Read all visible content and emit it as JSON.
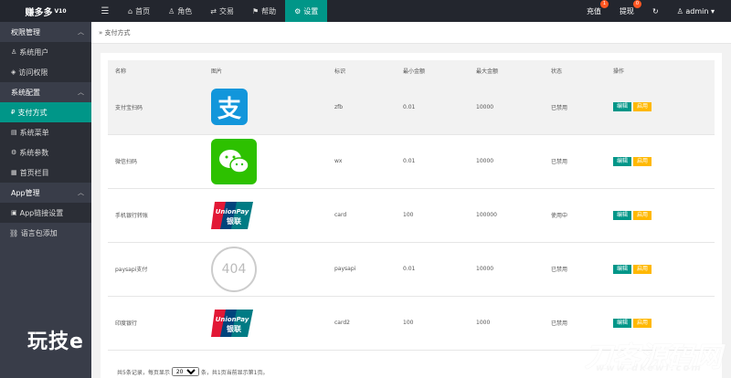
{
  "app": {
    "title": "赚多多",
    "version": "V10"
  },
  "topbar": {
    "menu_icon": "menu-icon",
    "nav": [
      {
        "icon": "⌂",
        "label": "首页",
        "active": false
      },
      {
        "icon": "♙",
        "label": "角色",
        "active": false
      },
      {
        "icon": "⇄",
        "label": "交易",
        "active": false
      },
      {
        "icon": "⚑",
        "label": "帮助",
        "active": false
      },
      {
        "icon": "⚙",
        "label": "设置",
        "active": true
      }
    ],
    "right": {
      "recharge": "充值",
      "recharge_badge": "1",
      "withdraw": "提现",
      "withdraw_badge": "0",
      "refresh_icon": "↻",
      "user": "admin"
    }
  },
  "sidebar": {
    "g1": "权限管理",
    "g1_items": [
      {
        "icon": "♙",
        "label": "系统用户"
      },
      {
        "icon": "◈",
        "label": "访问权限"
      }
    ],
    "g2": "系统配置",
    "g2_items": [
      {
        "icon": "₽",
        "label": "支付方式"
      },
      {
        "icon": "▤",
        "label": "系统菜单"
      },
      {
        "icon": "⚙",
        "label": "系统参数"
      },
      {
        "icon": "▦",
        "label": "首页栏目"
      }
    ],
    "g3": "App管理",
    "g3_items": [
      {
        "icon": "▣",
        "label": "App链接设置"
      }
    ],
    "extra": {
      "icon": "🔗",
      "label": "语言包添加"
    }
  },
  "breadcrumb": {
    "sep": "»",
    "label": "支付方式"
  },
  "table": {
    "headers": [
      "名称",
      "图片",
      "标识",
      "最小金额",
      "最大金额",
      "状态",
      "操作"
    ],
    "rows": [
      {
        "name": "支付宝扫码",
        "img": "alipay",
        "code": "zfb",
        "min": "0.01",
        "max": "10000",
        "status": "已禁用",
        "on": false
      },
      {
        "name": "微信扫码",
        "img": "wechat",
        "code": "wx",
        "min": "0.01",
        "max": "10000",
        "status": "已禁用",
        "on": false
      },
      {
        "name": "手机银行转账",
        "img": "unionpay",
        "code": "card",
        "min": "100",
        "max": "100000",
        "status": "使用中",
        "on": true
      },
      {
        "name": "paysapi支付",
        "img": "404",
        "code": "paysapi",
        "min": "0.01",
        "max": "10000",
        "status": "已禁用",
        "on": false
      },
      {
        "name": "印度银行",
        "img": "unionpay",
        "code": "card2",
        "min": "100",
        "max": "1000",
        "status": "已禁用",
        "on": false
      }
    ],
    "edit_label": "编辑",
    "enable_label": "启用"
  },
  "footer": {
    "prefix": "共5条记录，每页显示",
    "page_size": "20",
    "suffix": "条，共1页当前显示第1页。"
  },
  "img_text": {
    "alipay": "支",
    "unionpay_top": "UnionPay",
    "unionpay_bottom": "银联",
    "not_found": "404"
  },
  "watermarks": {
    "left": "玩技e",
    "right": "刀客源码网",
    "url": "www.dkewl.com"
  }
}
